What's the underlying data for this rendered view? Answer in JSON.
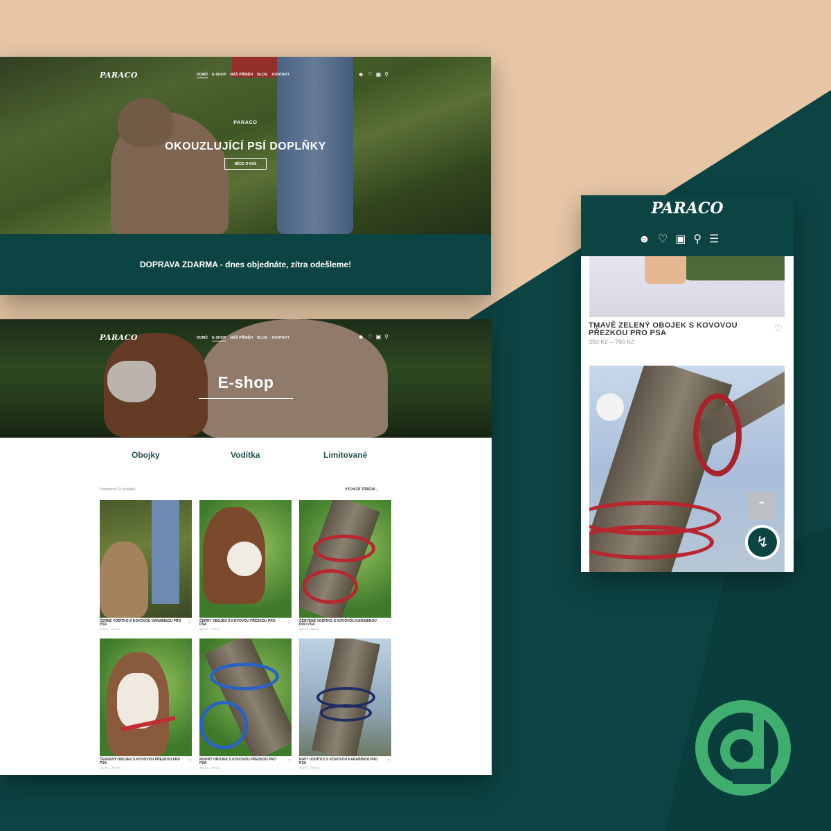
{
  "brand": {
    "name": "PARACO",
    "accent": "#0c4443",
    "sand": "#e6c6a5"
  },
  "nav": {
    "links": [
      "DOMŮ",
      "E-SHOP",
      "NÁŠ PŘÍBĚH",
      "BLOG",
      "KONTAKT"
    ],
    "icons": [
      "user-icon",
      "heart-icon",
      "cart-icon",
      "search-icon"
    ]
  },
  "home": {
    "kicker": "PARACO",
    "headline": "OKOUZLUJÍCÍ PSÍ DOPLŇKY",
    "cta": "NĚCO O NÁS",
    "shipping": "DOPRAVA ZDARMA - dnes objednáte, zítra odešleme!"
  },
  "eshop": {
    "title": "E-shop",
    "categories": [
      "Obojky",
      "Vodítka",
      "Limitované"
    ],
    "results": "Zobrazeno 23 výsledků",
    "sort": "VÝCHOZÍ TŘÍDĚNÍ",
    "products": [
      {
        "name": "ČERNÉ VODÍTKO S KOVOVOU KARABINOU PRO PSA",
        "price": "390 Kč – 550 Kč"
      },
      {
        "name": "ČERNÝ OBOJEK S KOVOVOU PŘEZKOU PRO PSA",
        "price": "350 Kč – 790 Kč"
      },
      {
        "name": "ČERVENÉ VODÍTKO S KOVOVOU KARABINOU PRO PSA",
        "price": "390 Kč – 550 Kč"
      },
      {
        "name": "ČERVENÝ OBOJEK S KOVOVOU PŘEZKOU PRO PSA",
        "price": "350 Kč – 790 Kč"
      },
      {
        "name": "MODRÝ OBOJEK S KOVOVOU PŘEZKOU PRO PSA",
        "price": "350 Kč – 790 Kč"
      },
      {
        "name": "NAVY VODÍTKO S KOVOVOU KARABINOU PRO PSA",
        "price": "390 Kč – 550 Kč"
      }
    ]
  },
  "mobile": {
    "logo": "PARACO",
    "product_name": "TMAVĚ ZELENÝ OBOJEK S KOVOVOU PŘEZKOU PRO PSA",
    "product_price": "350 Kč – 790 Kč"
  }
}
